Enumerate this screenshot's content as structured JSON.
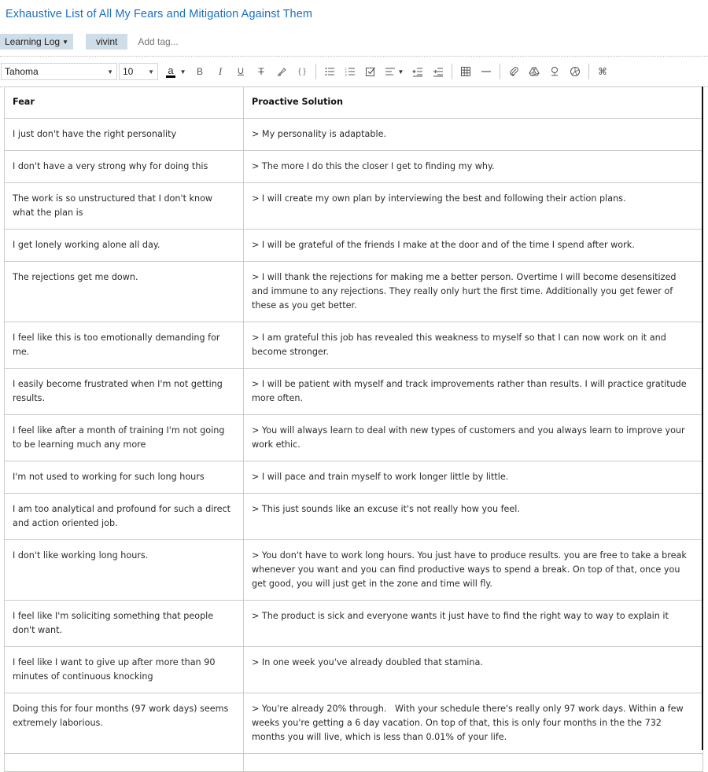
{
  "note": {
    "title": "Exhaustive List of All My Fears and Mitigation Against Them",
    "notebook": "Learning Log",
    "tags": [
      "vivint"
    ],
    "add_tag_placeholder": "Add tag..."
  },
  "toolbar": {
    "font_family": "Tahoma",
    "font_size": "10",
    "text_color_label": "a",
    "text_color": "#000000",
    "buttons": [
      "bold",
      "italic",
      "underline",
      "strikethrough",
      "highlight",
      "code-block",
      "bulleted-list",
      "numbered-list",
      "checkbox",
      "align",
      "outdent",
      "indent",
      "table",
      "horizontal-rule",
      "attachment",
      "google-drive",
      "image-upload",
      "sketch",
      "shortcuts"
    ]
  },
  "table": {
    "headers": [
      "Fear",
      "Proactive Solution"
    ],
    "rows": [
      {
        "fear": "I just don't have the right personality",
        "solution": "> My personality is adaptable."
      },
      {
        "fear": "I don't have a very strong why for doing this",
        "solution": "> The more I do this the closer I get to finding my why."
      },
      {
        "fear": "The work is so unstructured that I don't know what the plan is",
        "solution": "> I will create my own plan by interviewing the best and following their action plans."
      },
      {
        "fear": "I get lonely working alone all day.",
        "solution": "> I will be grateful of the friends I make at the door and of the time I spend after work."
      },
      {
        "fear": "The rejections get me down.",
        "solution": "> I will thank the rejections for making me a better person. Overtime I will become desensitized and immune to any rejections. They really only hurt the first time. Additionally you get fewer of these as you get better."
      },
      {
        "fear": "I feel like this is too emotionally demanding for me.",
        "solution": "> I am grateful this job has revealed this weakness to myself so that I can now work on it and become stronger."
      },
      {
        "fear": "I easily become frustrated when I'm not getting results.",
        "solution": "> I will be patient with myself and track improvements rather than results. I will practice gratitude more often."
      },
      {
        "fear": "I feel like after a month of training I'm not going to be learning much any more",
        "solution": "> You will always learn to deal with new types of customers and you always learn to improve your work ethic."
      },
      {
        "fear": "I'm not used to working for such long hours",
        "solution": "> I will pace and train myself to work longer little by little."
      },
      {
        "fear": "I am too analytical and profound for such a direct and action oriented job.",
        "solution": "> This just sounds like an excuse it's not really how you feel."
      },
      {
        "fear": "I don't like working long hours.",
        "solution": "> You don't have to work long hours. You just have to produce results. you are free to take a break whenever you want and you can find productive ways to spend a break. On top of that, once you get good, you will just get in the zone and time will fly."
      },
      {
        "fear": "I feel like I'm soliciting something that people don't want.",
        "solution": "> The product is sick and everyone wants it just have to find the right way to way to explain it"
      },
      {
        "fear": "I feel like I want to give up after more than 90 minutes of continuous knocking",
        "solution": "> In one week you've already doubled that stamina."
      },
      {
        "fear": "Doing this for four months (97 work days) seems extremely laborious.",
        "solution": "> You're already 20% through.   With your schedule there's really only 97 work days. Within a few weeks you're getting a 6 day vacation. On top of that, this is only four months in the the 732 months you will live, which is less than 0.01% of your life."
      },
      {
        "fear": "",
        "solution": ""
      }
    ]
  }
}
